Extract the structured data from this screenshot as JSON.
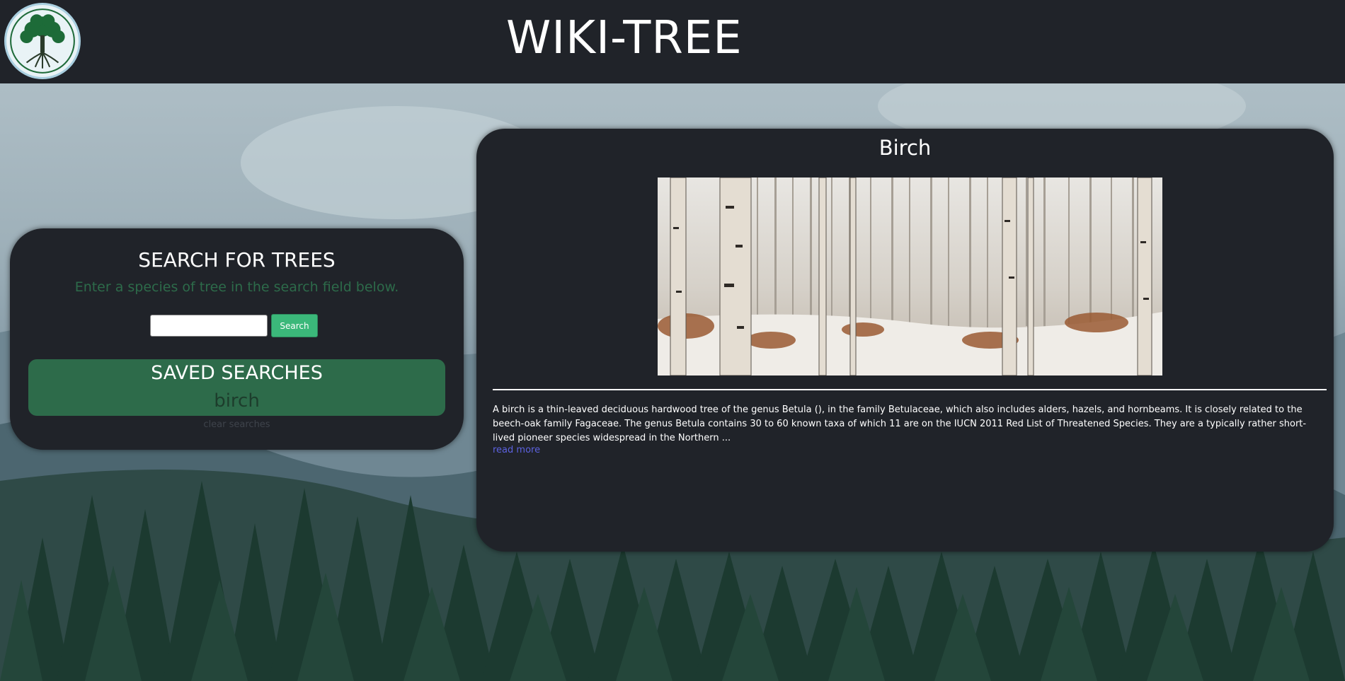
{
  "header": {
    "site_title": "WIKI-TREE",
    "logo_icon": "tree-of-life-logo"
  },
  "search": {
    "heading": "SEARCH FOR TREES",
    "subtitle": "Enter a species of tree in the search field below.",
    "input_value": "",
    "input_placeholder": "",
    "button_label": "Search"
  },
  "saved": {
    "heading": "SAVED SEARCHES",
    "items": [
      "birch"
    ],
    "clear_label": "clear searches"
  },
  "result": {
    "title": "Birch",
    "image_description_icon": "birch-forest-photo",
    "summary": "A birch is a thin-leaved deciduous hardwood tree of the genus Betula (), in the family Betulaceae, which also includes alders, hazels, and hornbeams. It is closely related to the beech-oak family Fagaceae. The genus Betula contains 30 to 60 known taxa of which 11 are on the IUCN 2011 Red List of Threatened Species. They are a typically rather short-lived pioneer species widespread in the Northern ...",
    "read_more_label": "read more"
  },
  "colors": {
    "header_bg": "#202329",
    "card_bg": "#202329",
    "accent_green": "#2d6b4a",
    "button_green": "#3bb87a",
    "link_blue": "#5c62e0"
  }
}
